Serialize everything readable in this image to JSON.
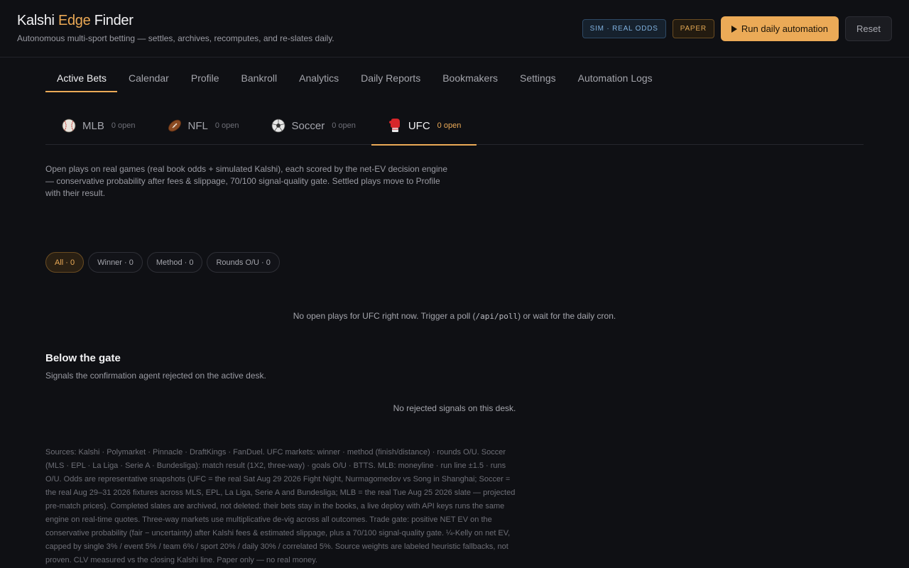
{
  "app": {
    "brand_start": "Kalshi ",
    "brand_accent": "Edge",
    "brand_end": " Finder",
    "subtitle": "Autonomous multi-sport betting — settles, archives, recomputes, and re-slates daily.",
    "sim_badge": "SIM · REAL ODDS",
    "paper_badge": "PAPER",
    "run_label": "Run daily automation",
    "reset_label": "Reset"
  },
  "nav": {
    "items": [
      {
        "label": "Active Bets",
        "active": true
      },
      {
        "label": "Calendar"
      },
      {
        "label": "Profile"
      },
      {
        "label": "Bankroll"
      },
      {
        "label": "Analytics"
      },
      {
        "label": "Daily Reports"
      },
      {
        "label": "Bookmakers"
      },
      {
        "label": "Settings"
      },
      {
        "label": "Automation Logs"
      }
    ]
  },
  "sports": [
    {
      "name": "MLB",
      "count": "0 open",
      "icon": "baseball-icon"
    },
    {
      "name": "NFL",
      "count": "0 open",
      "icon": "football-icon"
    },
    {
      "name": "Soccer",
      "count": "0 open",
      "icon": "soccer-ball-icon"
    },
    {
      "name": "UFC",
      "count": "0 open",
      "icon": "boxing-glove-icon",
      "active": true
    }
  ],
  "description": "Open plays on real games (real book odds + simulated Kalshi), each scored by the net-EV decision engine — conservative probability after fees & slippage, 70/100 signal-quality gate. Settled plays move to Profile with their result.",
  "filters": [
    {
      "label": "All · 0",
      "active": true
    },
    {
      "label": "Winner · 0"
    },
    {
      "label": "Method · 0"
    },
    {
      "label": "Rounds O/U · 0"
    }
  ],
  "empty_state": {
    "before": "No open plays for UFC right now. Trigger a poll (",
    "code": "/api/poll",
    "after": ") or wait for the daily cron."
  },
  "gate": {
    "title": "Below the gate",
    "subtitle": "Signals the confirmation agent rejected on the active desk.",
    "empty": "No rejected signals on this desk."
  },
  "footnote": "Sources: Kalshi · Polymarket · Pinnacle · DraftKings · FanDuel. UFC markets: winner · method (finish/distance) · rounds O/U. Soccer (MLS · EPL · La Liga · Serie A · Bundesliga): match result (1X2, three-way) · goals O/U · BTTS. MLB: moneyline · run line ±1.5 · runs O/U. Odds are representative snapshots (UFC = the real Sat Aug 29 2026 Fight Night, Nurmagomedov vs Song in Shanghai; Soccer = the real Aug 29–31 2026 fixtures across MLS, EPL, La Liga, Serie A and Bundesliga; MLB = the real Tue Aug 25 2026 slate — projected pre-match prices). Completed slates are archived, not deleted: their bets stay in the books, a live deploy with API keys runs the same engine on real-time quotes. Three-way markets use multiplicative de-vig across all outcomes. Trade gate: positive NET EV on the conservative probability (fair − uncertainty) after Kalshi fees & estimated slippage, plus a 70/100 signal-quality gate. ¼-Kelly on net EV, capped by single 3% / event 5% / team 6% / sport 20% / daily 30% / correlated 5%. Source weights are labeled heuristic fallbacks, not proven. CLV measured vs the closing Kalshi line. Paper only — no real money.",
  "colors": {
    "accent": "#ebaa57",
    "background": "#0f1014",
    "sim_blue": "#7fb0de"
  }
}
